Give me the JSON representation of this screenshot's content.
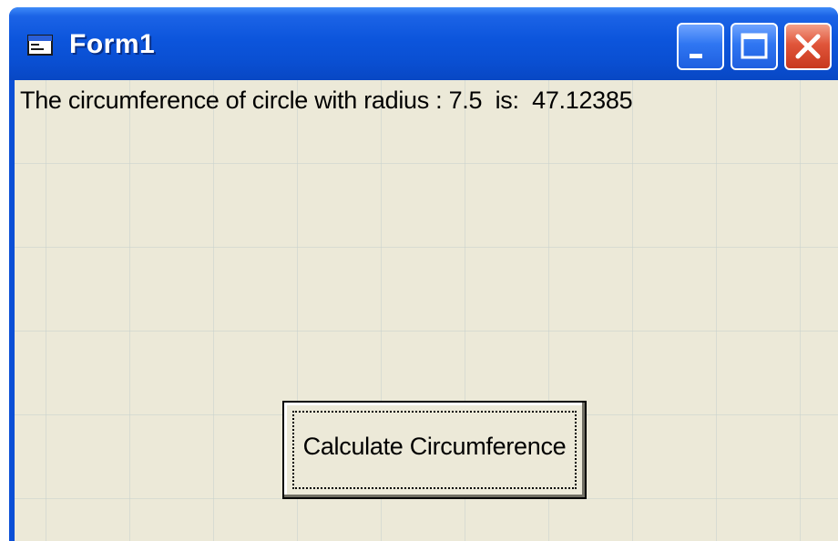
{
  "window": {
    "title": "Form1",
    "icon": "form-window-icon",
    "controls": {
      "minimize_icon": "minimize-icon",
      "maximize_icon": "maximize-icon",
      "close_icon": "close-icon"
    },
    "colors": {
      "titlebar": "#0c55dc",
      "client_background": "#ece9d8",
      "close_button": "#e0553a"
    }
  },
  "form": {
    "output_text": "The circumference of circle with radius : 7.5  is:  47.12385",
    "button_label": "Calculate Circumference"
  }
}
